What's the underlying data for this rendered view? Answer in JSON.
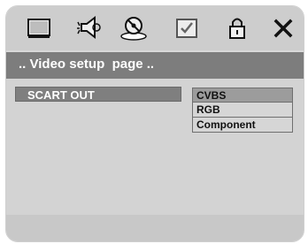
{
  "menu": {
    "icons": [
      {
        "name": "tv-screen-icon"
      },
      {
        "name": "audio-speaker-icon"
      },
      {
        "name": "video-disc-icon",
        "selected": true
      },
      {
        "name": "preference-checkbox-icon"
      },
      {
        "name": "lock-icon"
      },
      {
        "name": "close-icon"
      }
    ]
  },
  "title": ".. Video setup  page ..",
  "setting": {
    "label": "SCART OUT",
    "options": [
      "CVBS",
      "RGB",
      "Component"
    ],
    "selected_option": "CVBS"
  },
  "colors": {
    "title_bar": "#7d7d7d",
    "highlight": "#7f7f7f",
    "background": "#d3d3d3"
  }
}
